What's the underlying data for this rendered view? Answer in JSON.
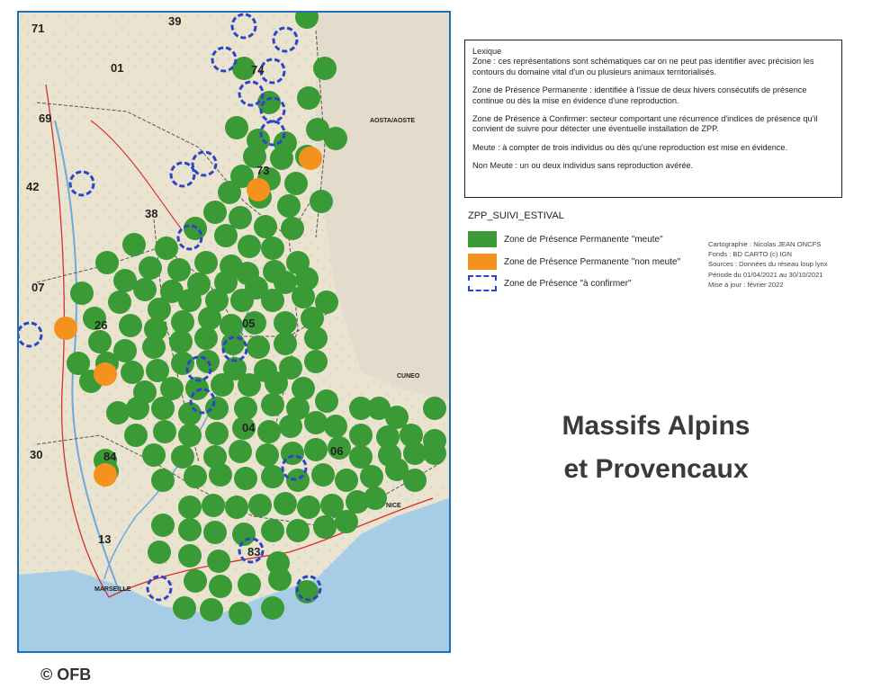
{
  "colors": {
    "meute": "#3a9a35",
    "non_meute": "#f5921e",
    "a_confirmer": "#2b45c8",
    "frame": "#1e6fb3",
    "sea": "#a7cde6"
  },
  "map": {
    "departements": [
      "39",
      "71",
      "01",
      "74",
      "69",
      "73",
      "42",
      "38",
      "07",
      "26",
      "05",
      "04",
      "06",
      "84",
      "30",
      "13",
      "83"
    ],
    "cities": [
      "MARSEILLE",
      "NICE",
      "CUNEO",
      "AOSTA/AOSTE"
    ],
    "zones_meute_count": 162,
    "zones_non_meute_count": 5,
    "zones_a_confirmer_count": 19
  },
  "lexique": {
    "title": "Lexique",
    "zone": "Zone : ces représentations sont schématiques car on ne peut pas identifier avec précision les contours du domaine vital d'un ou plusieurs animaux territorialisés.",
    "zpp": "Zone de Présence Permanente : identifiée à l'issue de deux hivers consécutifs de présence continue ou dès la mise en évidence d'une reproduction.",
    "zpc": "Zone de Présence à Confirmer: secteur comportant une récurrence d'indices de présence qu'il convient de suivre pour détecter une éventuelle installation de ZPP.",
    "meute": "Meute : à compter de trois individus ou dès qu'une reproduction est mise en évidence.",
    "non_meute": "Non Meute : un ou deux individus sans reproduction avérée."
  },
  "legend": {
    "title": "ZPP_SUIVI_ESTIVAL",
    "items": [
      {
        "label": "Zone de Présence Permanente \"meute\""
      },
      {
        "label": "Zone de Présence Permanente \"non meute\""
      },
      {
        "label": "Zone de Présence \"à confirmer\""
      }
    ]
  },
  "credits": {
    "line1": "Cartographie : Nicolas JEAN ONCFS",
    "line2": "Fonds : BD CARTO (c) IGN",
    "line3": "Sources : Données du réseau loup lynx",
    "line4": "Période du 01/04/2021 au 30/10/2021",
    "line5": "Mise à jour : février 2022"
  },
  "title": {
    "line1": "Massifs Alpins",
    "line2": "et Provencaux"
  },
  "copyright": "© OFB"
}
